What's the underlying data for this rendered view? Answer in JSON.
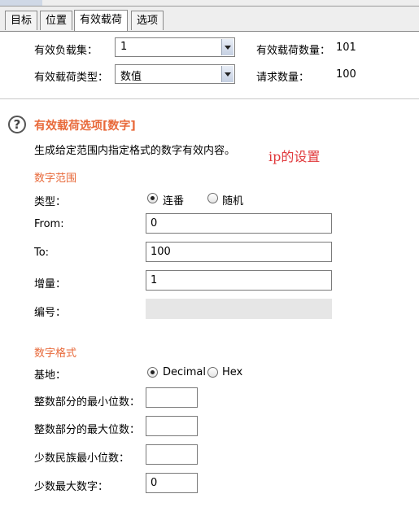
{
  "tabs": [
    "目标",
    "位置",
    "有效载荷",
    "选项"
  ],
  "payload_sets": {
    "set_label": "有效负载集：",
    "set_value": "1",
    "count_label": "有效载荷数量：",
    "count_value": "101",
    "type_label": "有效载荷类型：",
    "type_value": "数值",
    "request_label": "请求数量：",
    "request_value": "100"
  },
  "options": {
    "title": "有效载荷选项[数字]",
    "description": "生成给定范围内指定格式的数字有效内容。",
    "annotation": "ip的设置"
  },
  "range": {
    "heading": "数字范围",
    "type_label": "类型：",
    "type_options": [
      "连番",
      "随机"
    ],
    "type_selected": "连番",
    "from_label": "From:",
    "from_value": "0",
    "to_label": "To:",
    "to_value": "100",
    "step_label": "增量：",
    "step_value": "1",
    "number_label": "编号：",
    "number_value": ""
  },
  "format": {
    "heading": "数字格式",
    "base_label": "基地：",
    "base_options": [
      "Decimal",
      "Hex"
    ],
    "base_selected": "Decimal",
    "min_int_label": "整数部分的最小位数：",
    "min_int_value": "",
    "max_int_label": "整数部分的最大位数：",
    "max_int_value": "",
    "min_frac_label": "少数民族最小位数：",
    "min_frac_value": "",
    "max_frac_label": "少数最大数字：",
    "max_frac_value": "0"
  }
}
